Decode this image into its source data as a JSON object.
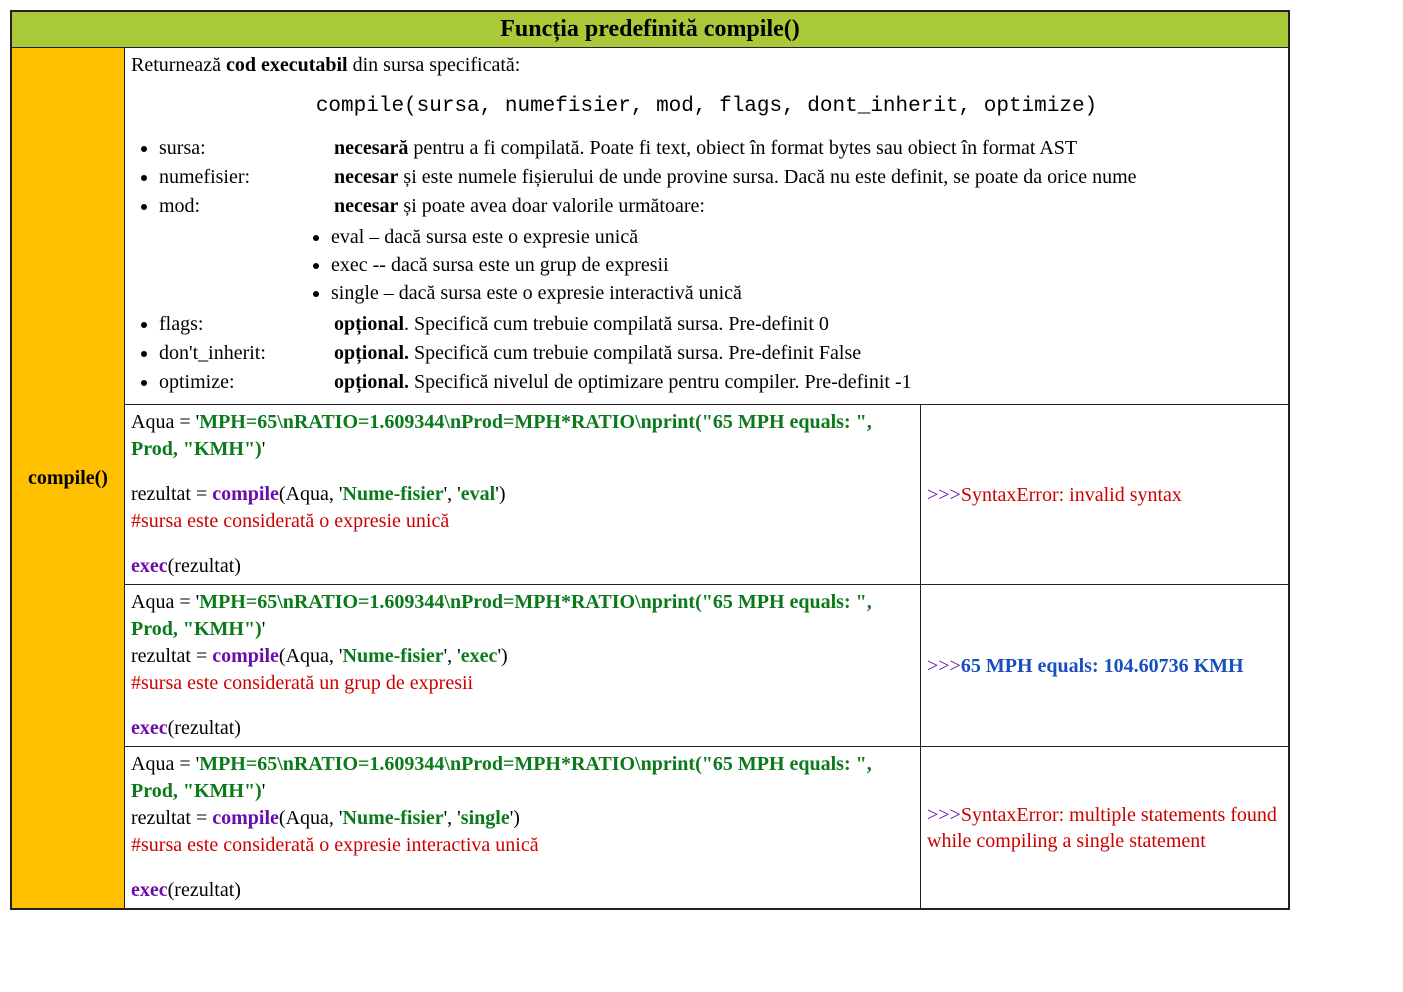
{
  "title": "Funcția predefinită compile()",
  "fn_label": "compile()",
  "desc": {
    "intro_1": "Returnează ",
    "intro_bold": "cod executabil",
    "intro_2": " din sursa specificată:",
    "signature": "compile(sursa, numefisier, mod, flags, dont_inherit, optimize)",
    "params": {
      "sursa": {
        "label": "sursa:",
        "req": "necesară",
        "text": " pentru a fi compilată. Poate fi text, obiect în format bytes sau obiect în format AST"
      },
      "numefisier": {
        "label": "numefisier:",
        "req": "necesar",
        "text": " și este numele fișierului de unde provine sursa. Dacă nu este definit, se poate da orice nume"
      },
      "mod": {
        "label": "mod:",
        "req": "necesar",
        "text": " și poate avea doar valorile următoare:"
      },
      "mod_sub": {
        "eval": "eval – dacă sursa este o expresie unică",
        "exec": "exec -- dacă sursa este un grup de expresii",
        "single": "single – dacă sursa este o expresie interactivă unică"
      },
      "flags": {
        "label": "flags:",
        "req": "opțional",
        "text": ". Specifică cum trebuie compilată sursa. Pre-definit 0"
      },
      "dont_inherit": {
        "label": "don't_inherit:",
        "req": "opțional.",
        "text": " Specifică cum trebuie compilată sursa. Pre-definit False"
      },
      "optimize": {
        "label": "optimize:",
        "req": "opțional.",
        "text": " Specifică nivelul de optimizare pentru compiler. Pre-definit -1"
      }
    }
  },
  "ex": {
    "aqua_lhs": "Aqua = '",
    "aqua_str": "MPH=65\\nRATIO=1.609344\\nProd=MPH*RATIO\\nprint(\"65 MPH equals: \", Prod, \"KMH\")",
    "aqua_end": "'",
    "rez_lhs": "rezultat = ",
    "compile": "compile",
    "open_arg": "(Aqua, '",
    "fname": "Nume-fisier",
    "mid": "', '",
    "close": "')",
    "exec": "exec",
    "exec_arg": "(rezultat)",
    "prompt": ">>>",
    "row1": {
      "mode": "eval",
      "comment": "#sursa este considerată o expresie unică",
      "output": "SyntaxError: invalid syntax"
    },
    "row2": {
      "mode": "exec",
      "comment": "#sursa este considerată un grup de expresii",
      "output": "65 MPH equals:  104.60736 KMH"
    },
    "row3": {
      "mode": "single",
      "comment": "#sursa este considerată o expresie interactiva unică",
      "output": "SyntaxError: multiple statements found while compiling a single statement"
    }
  }
}
